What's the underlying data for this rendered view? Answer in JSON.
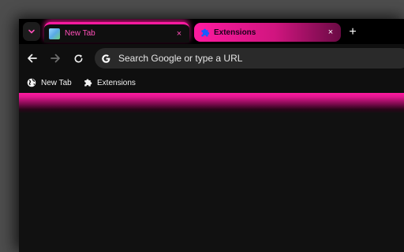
{
  "tabs": [
    {
      "title": "New Tab",
      "active": true,
      "favicon": "new-tab-favicon"
    },
    {
      "title": "Extensions",
      "active": false,
      "favicon": "puzzle-icon"
    }
  ],
  "tab_close_glyph": "×",
  "new_tab_glyph": "+",
  "omnibox": {
    "placeholder": "Search Google or type a URL",
    "value": ""
  },
  "bookmarks": [
    {
      "label": "New Tab",
      "icon": "globe-icon"
    },
    {
      "label": "Extensions",
      "icon": "puzzle-icon"
    }
  ],
  "theme": {
    "accent": "#ff1aa0",
    "frame": "#000000",
    "toolbar": "#0f0f0f",
    "page": "#111111"
  }
}
